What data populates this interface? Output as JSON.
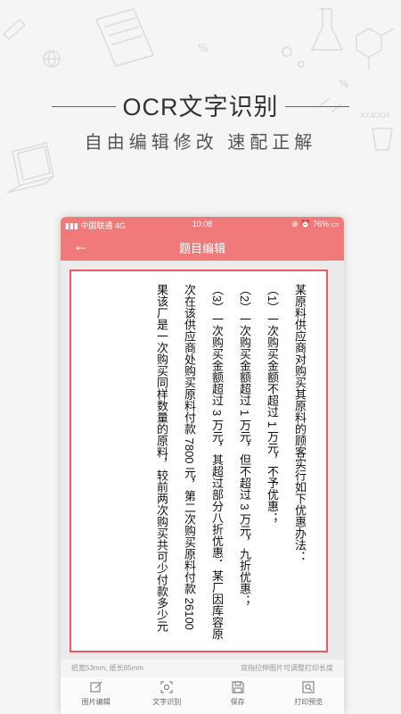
{
  "hero": {
    "title": "OCR文字识别",
    "subtitle": "自由编辑修改 速配正解"
  },
  "statusbar": {
    "carrier": "中国联通 4G",
    "time": "10:08",
    "battery": "76%"
  },
  "appbar": {
    "back_icon": "←",
    "title": "题目编辑"
  },
  "document": {
    "lines": [
      "某原料供应商对购买其原料的顾客实行如下优惠办法：",
      "（1）一次购买金额不超过 1 万元，不予优惠；",
      "（2）一次购买金额超过 1 万元，但不超过 3 万元，九折优惠；",
      "（3）一次购买金额超过 3 万元，其超过部分八折优惠．某厂因库容原",
      "次在该供应商处购买原料付款 7800 元，第二次购买原料付款 26100",
      "果该厂是一次购买同样数量的原料，较前两次购买共可少付款多少元"
    ]
  },
  "hint": {
    "left": "纸宽53mm, 纸长85mm",
    "right": "双指拉伸图片可调整打印长度"
  },
  "toolbar": {
    "items": [
      {
        "label": "图片编辑",
        "icon": "edit-icon"
      },
      {
        "label": "文字识别",
        "icon": "scan-icon"
      },
      {
        "label": "保存",
        "icon": "save-icon"
      },
      {
        "label": "打印预览",
        "icon": "preview-icon"
      }
    ]
  },
  "colors": {
    "accent": "#f07a7a",
    "paper_border": "#e85a66"
  }
}
